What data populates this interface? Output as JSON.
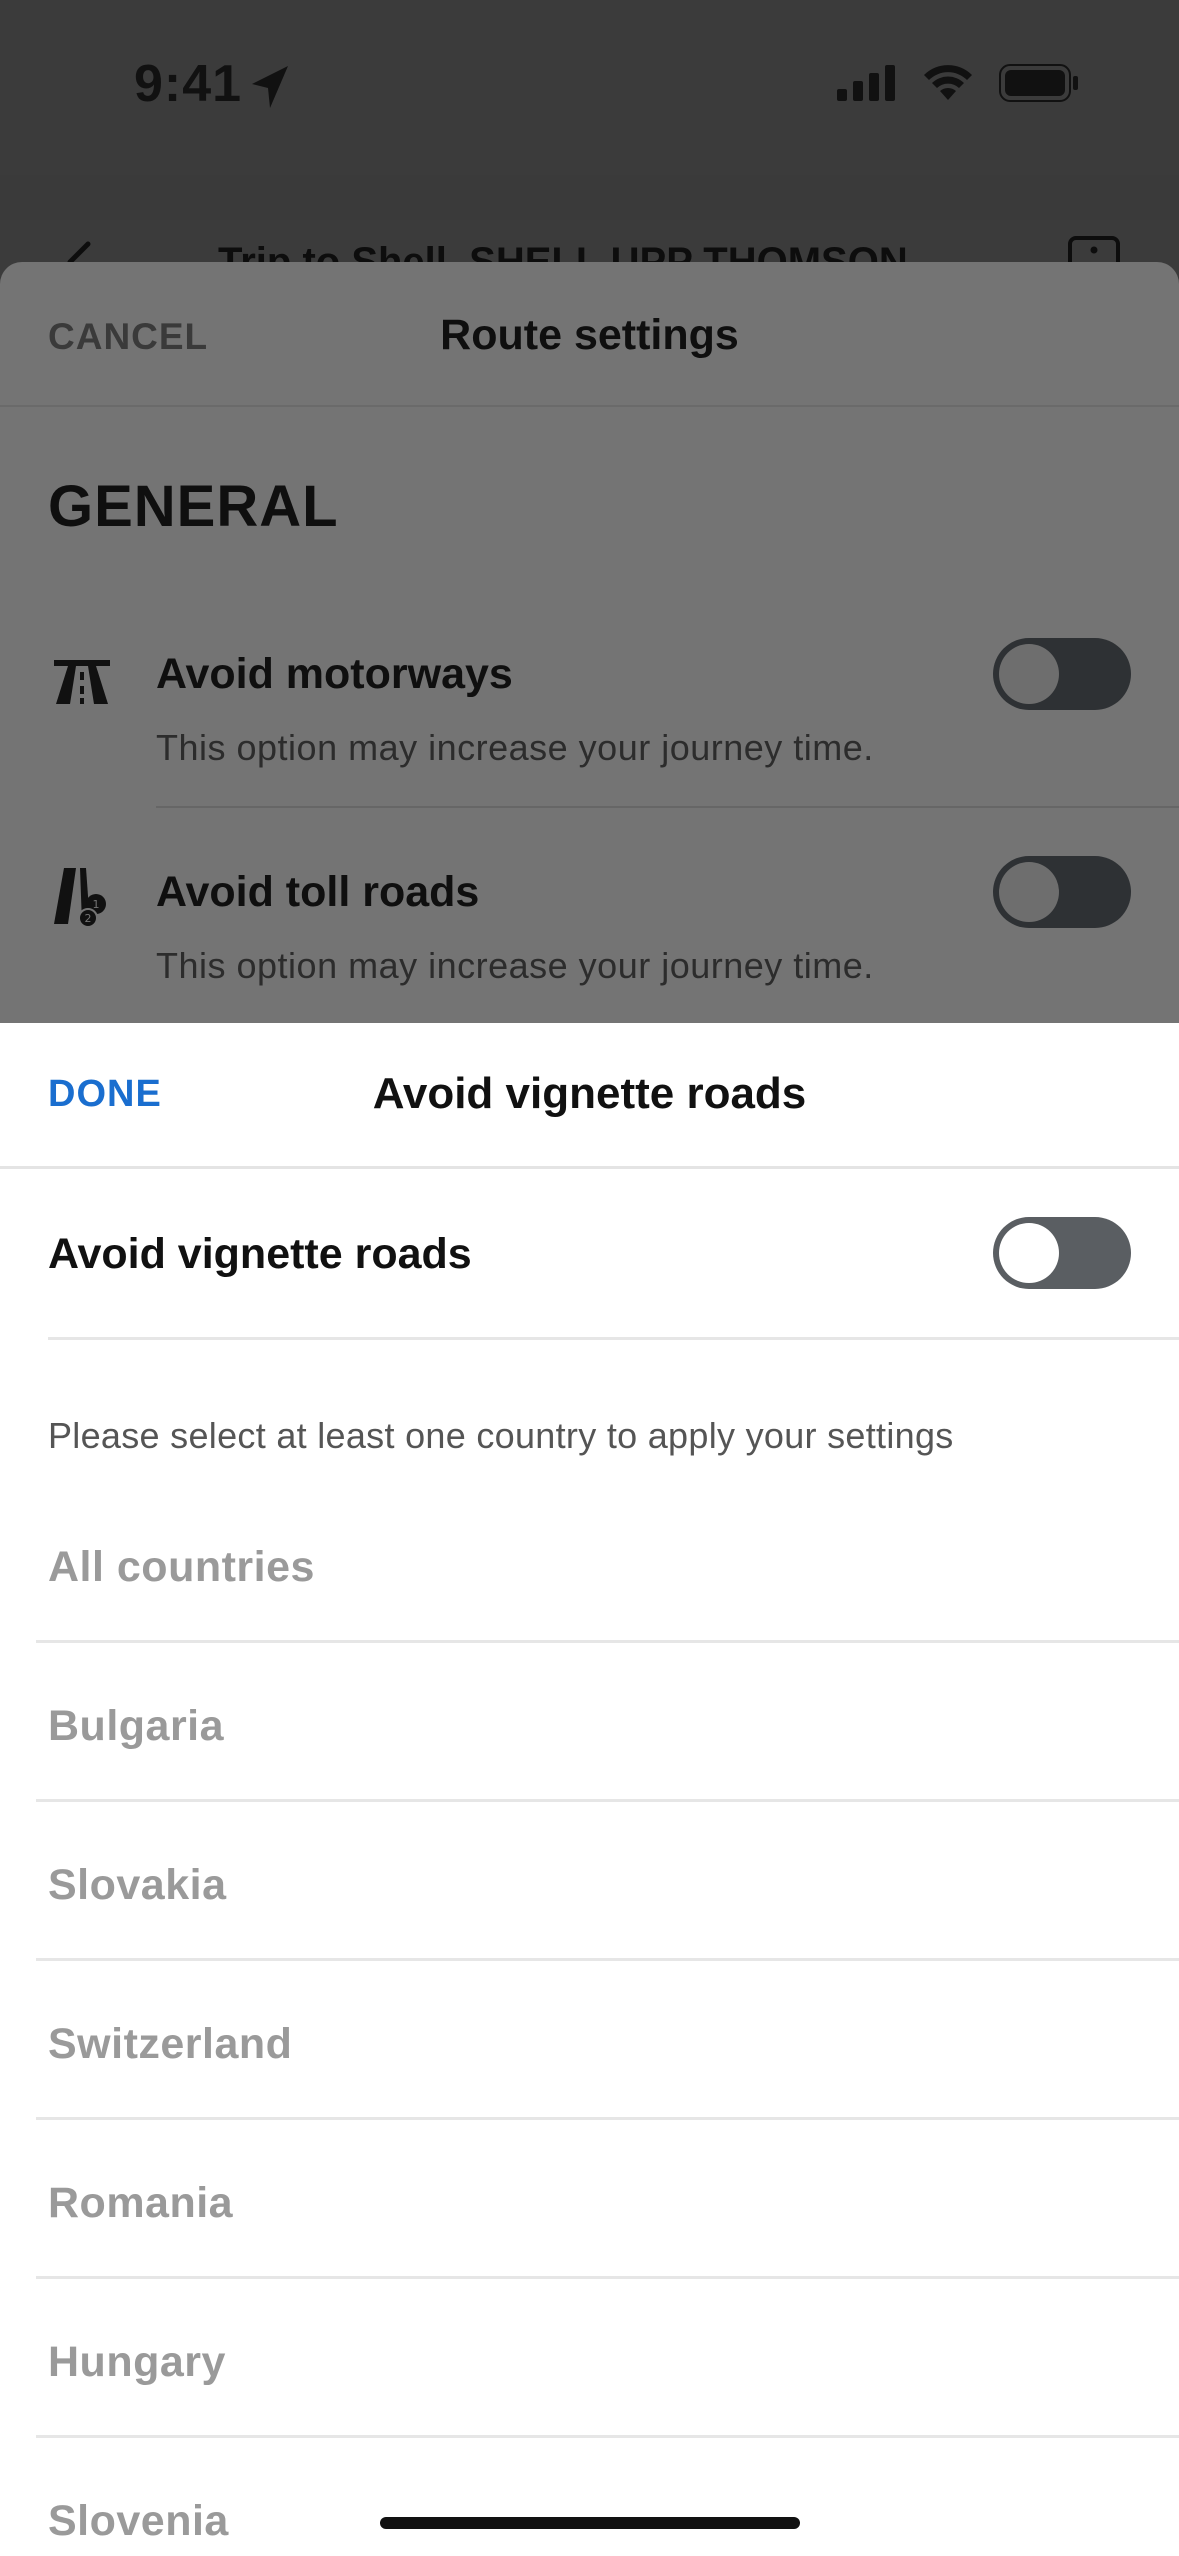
{
  "status_bar": {
    "time": "9:41"
  },
  "underlying_nav": {
    "title": "Trip to Shell, SHELL UPP THOMSON"
  },
  "route_settings": {
    "cancel_label": "CANCEL",
    "title": "Route settings",
    "section_heading": "GENERAL",
    "options": [
      {
        "label": "Avoid motorways",
        "subtitle": "This option may increase your journey time.",
        "icon": "motorway-icon",
        "enabled": false
      },
      {
        "label": "Avoid toll roads",
        "subtitle": "This option may increase your journey time.",
        "icon": "toll-road-icon",
        "enabled": false
      }
    ]
  },
  "vignette_sheet": {
    "done_label": "DONE",
    "title": "Avoid vignette roads",
    "toggle_label": "Avoid vignette roads",
    "toggle_enabled": false,
    "hint": "Please select at least one country to apply your settings",
    "countries": [
      "All countries",
      "Bulgaria",
      "Slovakia",
      "Switzerland",
      "Romania",
      "Hungary",
      "Slovenia"
    ]
  },
  "colors": {
    "accent": "#1a6ecf",
    "disabled_text": "#9a9a9a",
    "overlay": "#747474"
  }
}
